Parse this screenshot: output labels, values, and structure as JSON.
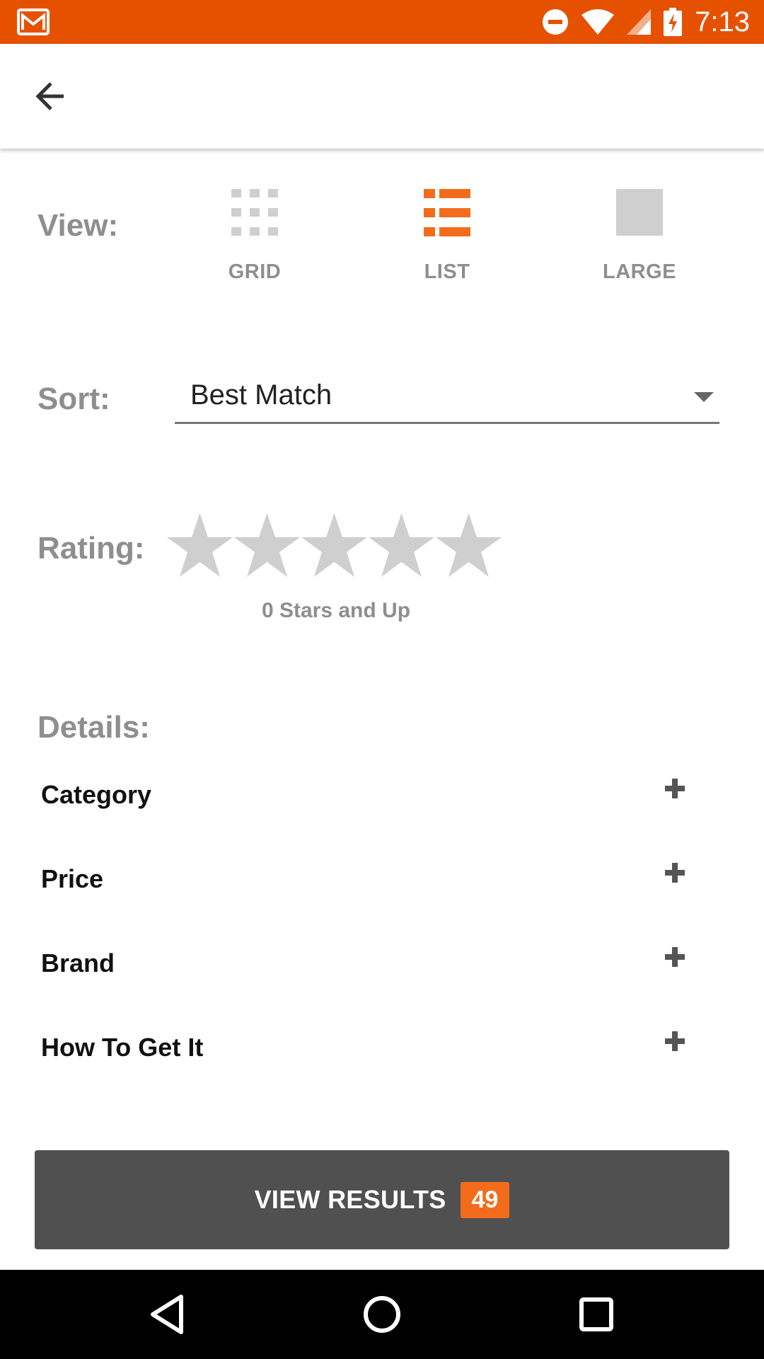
{
  "status_bar": {
    "time": "7:13",
    "icons": [
      "gmail-icon",
      "do-not-disturb-icon",
      "wifi-icon",
      "signal-icon",
      "battery-charging-icon"
    ]
  },
  "toolbar": {
    "back_icon": "arrow-back-icon"
  },
  "view": {
    "label": "View:",
    "selected": "LIST",
    "options": [
      {
        "label": "GRID",
        "icon": "grid-view-icon"
      },
      {
        "label": "LIST",
        "icon": "list-view-icon"
      },
      {
        "label": "LARGE",
        "icon": "large-view-icon"
      }
    ]
  },
  "sort": {
    "label": "Sort:",
    "value": "Best Match"
  },
  "rating": {
    "label": "Rating:",
    "stars_total": 5,
    "stars_selected": 0,
    "caption": "0 Stars and Up"
  },
  "details": {
    "label": "Details:",
    "items": [
      {
        "label": "Category"
      },
      {
        "label": "Price"
      },
      {
        "label": "Brand"
      },
      {
        "label": "How To Get It"
      }
    ]
  },
  "results_button": {
    "label": "VIEW RESULTS",
    "count": "49"
  },
  "colors": {
    "accent": "#F36C1B",
    "status_bar": "#E65100",
    "button": "#505050",
    "label_gray": "#8e8e8e",
    "star_gray": "#cfcfcf"
  }
}
